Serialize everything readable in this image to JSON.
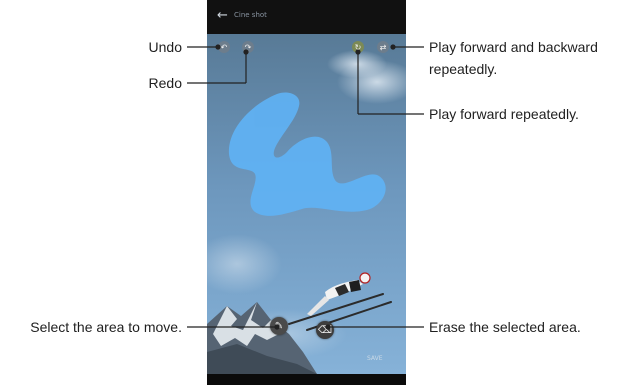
{
  "app": {
    "title": "Cine shot",
    "back_icon": "arrow-left-icon",
    "save_label": "SAVE"
  },
  "controls": {
    "undo": {
      "icon": "undo-icon",
      "glyph": "↶"
    },
    "redo": {
      "icon": "redo-icon",
      "glyph": "↷"
    },
    "play_forward": {
      "icon": "play-forward-icon",
      "glyph": "↻"
    },
    "play_bounce": {
      "icon": "play-forward-backward-icon",
      "glyph": "⇄"
    },
    "brush": {
      "icon": "brush-icon",
      "glyph": "✎"
    },
    "eraser": {
      "icon": "eraser-icon",
      "glyph": "⌫"
    }
  },
  "callouts": {
    "undo": "Undo",
    "redo": "Redo",
    "play_bounce_line1": "Play forward and backward",
    "play_bounce_line2": "repeatedly.",
    "play_forward": "Play forward repeatedly.",
    "select_area": "Select the area to move.",
    "erase_area": "Erase the selected area."
  },
  "colors": {
    "sky_top": "#5d7d98",
    "sky_bottom": "#7aa7cf",
    "selection": "#5fb2f4",
    "leader_line": "#222222"
  }
}
